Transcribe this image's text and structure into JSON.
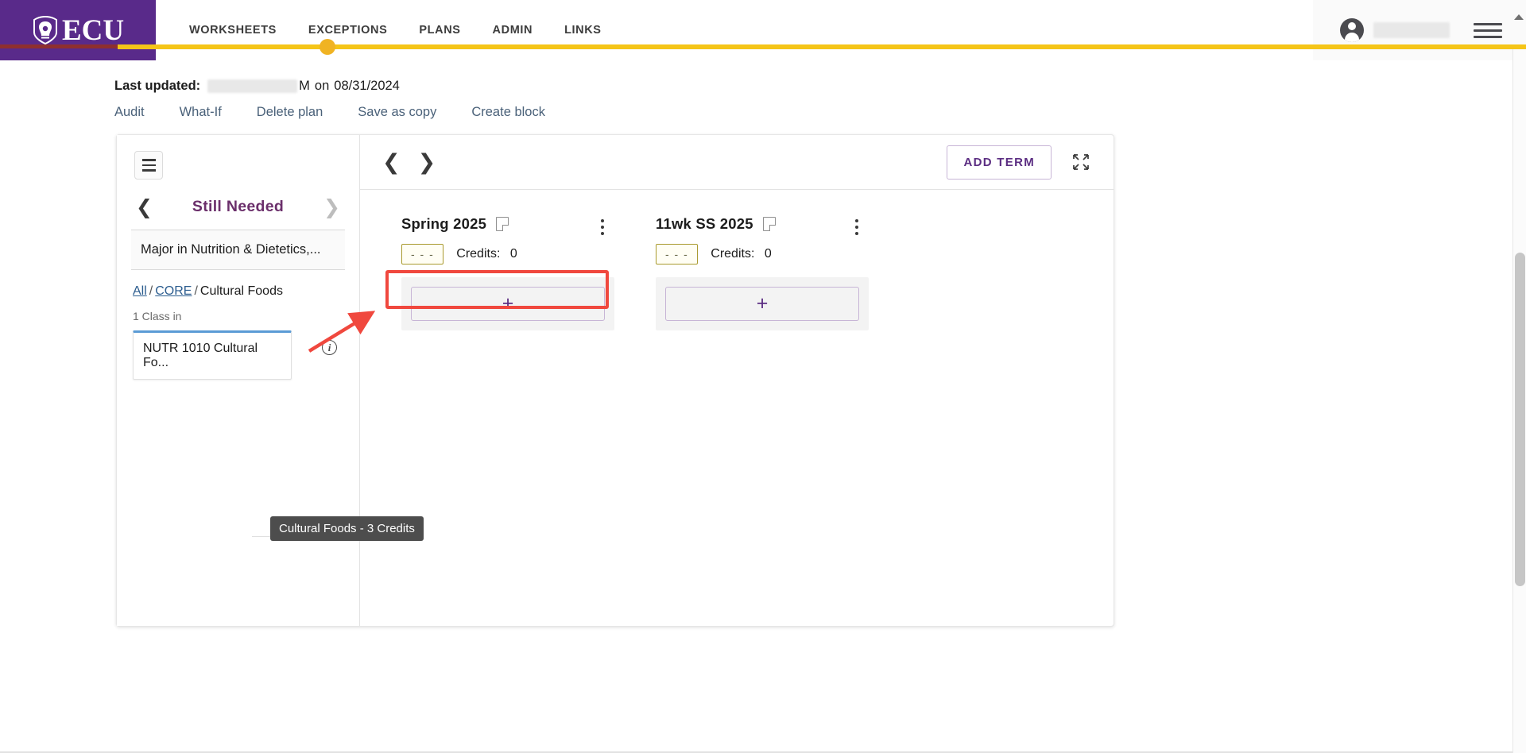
{
  "header": {
    "logo_text": "ECU",
    "logo_icon": "ecu-shield-icon",
    "nav_items": [
      {
        "label": "WORKSHEETS",
        "active": false
      },
      {
        "label": "EXCEPTIONS",
        "active": false
      },
      {
        "label": "PLANS",
        "active": true
      },
      {
        "label": "ADMIN",
        "active": false
      },
      {
        "label": "LINKS",
        "active": false
      }
    ],
    "user_name_redacted": true,
    "avatar_icon": "user-avatar-icon",
    "menu_icon": "hamburger-menu-icon",
    "accent_color": "#f5c518",
    "brand_color": "#592a8a"
  },
  "plan": {
    "last_updated_label": "Last updated:",
    "last_updated_user_redacted": true,
    "last_updated_time_suffix": "M",
    "last_updated_on": "on",
    "last_updated_date": "08/31/2024",
    "actions": [
      {
        "label": "Audit"
      },
      {
        "label": "What-If"
      },
      {
        "label": "Delete plan"
      },
      {
        "label": "Save as copy"
      },
      {
        "label": "Create block"
      }
    ]
  },
  "left_panel": {
    "menu_icon": "hamburger-menu-icon",
    "prev_icon": "chevron-left-icon",
    "next_icon": "chevron-right-icon",
    "title": "Still Needed",
    "requirement": "Major in Nutrition & Dietetics,...",
    "breadcrumb": [
      {
        "label": "All",
        "link": true
      },
      {
        "label": "CORE",
        "link": true
      },
      {
        "label": "Cultural Foods",
        "link": false
      }
    ],
    "breadcrumb_separator": "/",
    "class_count": "1 Class in",
    "class_card": "NUTR  1010  Cultural Fo...",
    "info_icon": "info-circle-icon",
    "info_glyph": "i",
    "tooltip": "Cultural Foods - 3 Credits"
  },
  "right_panel": {
    "prev_icon": "chevron-left-icon",
    "next_icon": "chevron-right-icon",
    "add_term_label": "Add Term",
    "expand_icon": "expand-fullscreen-icon",
    "terms": [
      {
        "title": "Spring 2025",
        "note_icon": "note-icon",
        "kebab_icon": "more-vertical-icon",
        "badge": "- - -",
        "credits_label": "Credits:",
        "credits_value": "0",
        "add_label": "+",
        "highlighted": true
      },
      {
        "title": "11wk SS 2025",
        "note_icon": "note-icon",
        "kebab_icon": "more-vertical-icon",
        "badge": "- - -",
        "credits_label": "Credits:",
        "credits_value": "0",
        "add_label": "+",
        "highlighted": false
      }
    ]
  },
  "annotation": {
    "highlight_color": "#f0483e",
    "arrow_icon": "red-arrow-annotation"
  },
  "scrollbar": {
    "up_arrow_icon": "scroll-up-arrow-icon"
  }
}
